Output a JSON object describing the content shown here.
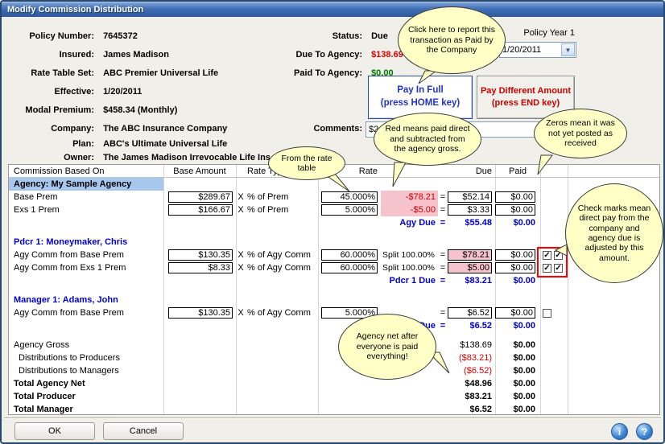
{
  "window": {
    "title": "Modify Commission Distribution"
  },
  "header": {
    "policy_number": {
      "label": "Policy Number:",
      "value": "7645372"
    },
    "insured": {
      "label": "Insured:",
      "value": "James Madison"
    },
    "rate_table_set": {
      "label": "Rate Table Set:",
      "value": "ABC Premier Universal Life"
    },
    "effective": {
      "label": "Effective:",
      "value": "1/20/2011"
    },
    "modal_premium": {
      "label": "Modal Premium:",
      "value": "$458.34 (Monthly)"
    },
    "company": {
      "label": "Company:",
      "value": "The ABC Insurance Company"
    },
    "plan": {
      "label": "Plan:",
      "value": "ABC's Ultimate Universal Life"
    },
    "owner": {
      "label": "Owner:",
      "value": "The James Madison Irrevocable Life Ins"
    },
    "status": {
      "label": "Status:",
      "value": "Due"
    },
    "due_to_agency": {
      "label": "Due To Agency:",
      "value": "$138.69"
    },
    "paid_to_agency": {
      "label": "Paid To Agency:",
      "value": "$0.00"
    },
    "comments": {
      "label": "Comments:",
      "value": "$2"
    },
    "policy_year": "Policy Year 1",
    "effective_date_dropdown": "1/20/2011",
    "dropdown_arrow": "▼",
    "pay_in_full": {
      "line1": "Pay In Full",
      "line2": "(press HOME key)"
    },
    "pay_different": {
      "line1": "Pay Different Amount",
      "line2": "(press END key)"
    }
  },
  "table": {
    "headers": {
      "based_on": "Commission Based On",
      "base_amount": "Base Amount",
      "rate_type": "Rate Type",
      "rate": "Rate",
      "due": "Due",
      "paid": "Paid"
    },
    "rows": [
      {
        "type": "section_hl",
        "label": "Agency: My Sample Agency"
      },
      {
        "type": "data",
        "label": "Base Prem",
        "base": "$289.67",
        "x": "X",
        "rate_type": "% of Prem",
        "rate": "45.000%",
        "adj": "-$78.21",
        "adj_style": "neg",
        "eq": "=",
        "due": "$52.14",
        "paid": "$0.00",
        "checks": []
      },
      {
        "type": "data",
        "label": "Exs 1 Prem",
        "base": "$166.67",
        "x": "X",
        "rate_type": "% of Prem",
        "rate": "5.000%",
        "adj": "-$5.00",
        "adj_style": "neg",
        "eq": "=",
        "due": "$3.33",
        "paid": "$0.00",
        "checks": []
      },
      {
        "type": "subtotal",
        "label": "Agy Due",
        "eq": "=",
        "due": "$55.48",
        "paid": "$0.00"
      },
      {
        "type": "spacer"
      },
      {
        "type": "section",
        "label": "Pdcr 1: Moneymaker, Chris"
      },
      {
        "type": "data",
        "label": "Agy Comm from Base Prem",
        "base": "$130.35",
        "x": "X",
        "rate_type": "% of Agy Comm",
        "rate": "60.000%",
        "adj": "Split 100.00%",
        "adj_style": "split",
        "eq": "=",
        "due": "$78.21",
        "due_pink": true,
        "paid": "$0.00",
        "checks": [
          true,
          true
        ]
      },
      {
        "type": "data",
        "label": "Agy Comm from Exs 1 Prem",
        "base": "$8.33",
        "x": "X",
        "rate_type": "% of Agy Comm",
        "rate": "60.000%",
        "adj": "Split 100.00%",
        "adj_style": "split",
        "eq": "=",
        "due": "$5.00",
        "due_pink": true,
        "paid": "$0.00",
        "checks": [
          true,
          true
        ]
      },
      {
        "type": "subtotal",
        "label": "Pdcr 1 Due",
        "eq": "=",
        "due": "$83.21",
        "paid": "$0.00"
      },
      {
        "type": "spacer"
      },
      {
        "type": "section",
        "label": "Manager 1: Adams, John"
      },
      {
        "type": "data",
        "label": "Agy Comm from Base Prem",
        "base": "$130.35",
        "x": "X",
        "rate_type": "% of Agy Comm",
        "rate": "5.000%",
        "adj": "",
        "adj_style": "",
        "eq": "=",
        "due": "$6.52",
        "paid": "$0.00",
        "checks": [
          false
        ]
      },
      {
        "type": "subtotal",
        "label": "Mgr 1 Due",
        "eq": "=",
        "due": "$6.52",
        "paid": "$0.00"
      },
      {
        "type": "spacer"
      },
      {
        "type": "summary",
        "label": "Agency Gross",
        "due": "$138.69",
        "paid": "$0.00",
        "due_style": "normal"
      },
      {
        "type": "summary",
        "label": "Distributions to Producers",
        "indent": true,
        "due": "($83.21)",
        "paid": "$0.00",
        "due_style": "negred"
      },
      {
        "type": "summary",
        "label": "Distributions to Managers",
        "indent": true,
        "due": "($6.52)",
        "paid": "$0.00",
        "due_style": "negred"
      },
      {
        "type": "summary",
        "label": "Total Agency Net",
        "bold": true,
        "due": "$48.96",
        "paid": "$0.00"
      },
      {
        "type": "summary",
        "label": "Total Producer",
        "bold": true,
        "due": "$83.21",
        "paid": "$0.00"
      },
      {
        "type": "summary",
        "label": "Total Manager",
        "bold": true,
        "due": "$6.52",
        "paid": "$0.00"
      }
    ]
  },
  "callouts": [
    {
      "text": "Click here to report this transaction as Paid by the Company"
    },
    {
      "text": "Red means paid direct and subtracted from the agency gross."
    },
    {
      "text": "From the rate table"
    },
    {
      "text": "Zeros mean it was not yet posted as received"
    },
    {
      "text": "Check marks mean direct pay from the company and agency due is adjusted by this amount."
    },
    {
      "text": "Agency net after everyone is paid everything!"
    }
  ],
  "footer": {
    "ok": "OK",
    "cancel": "Cancel",
    "info_icon": "i",
    "help_icon": "?"
  },
  "colors": {
    "due_red": "#dd0000",
    "paid_green": "#007700",
    "accent_blue": "#0000cc",
    "pink_highlight": "#f6c3cc",
    "row_highlight": "#a8c7ee",
    "callout_yellow": "#ffffc6",
    "annotation_red": "#ff0000"
  }
}
